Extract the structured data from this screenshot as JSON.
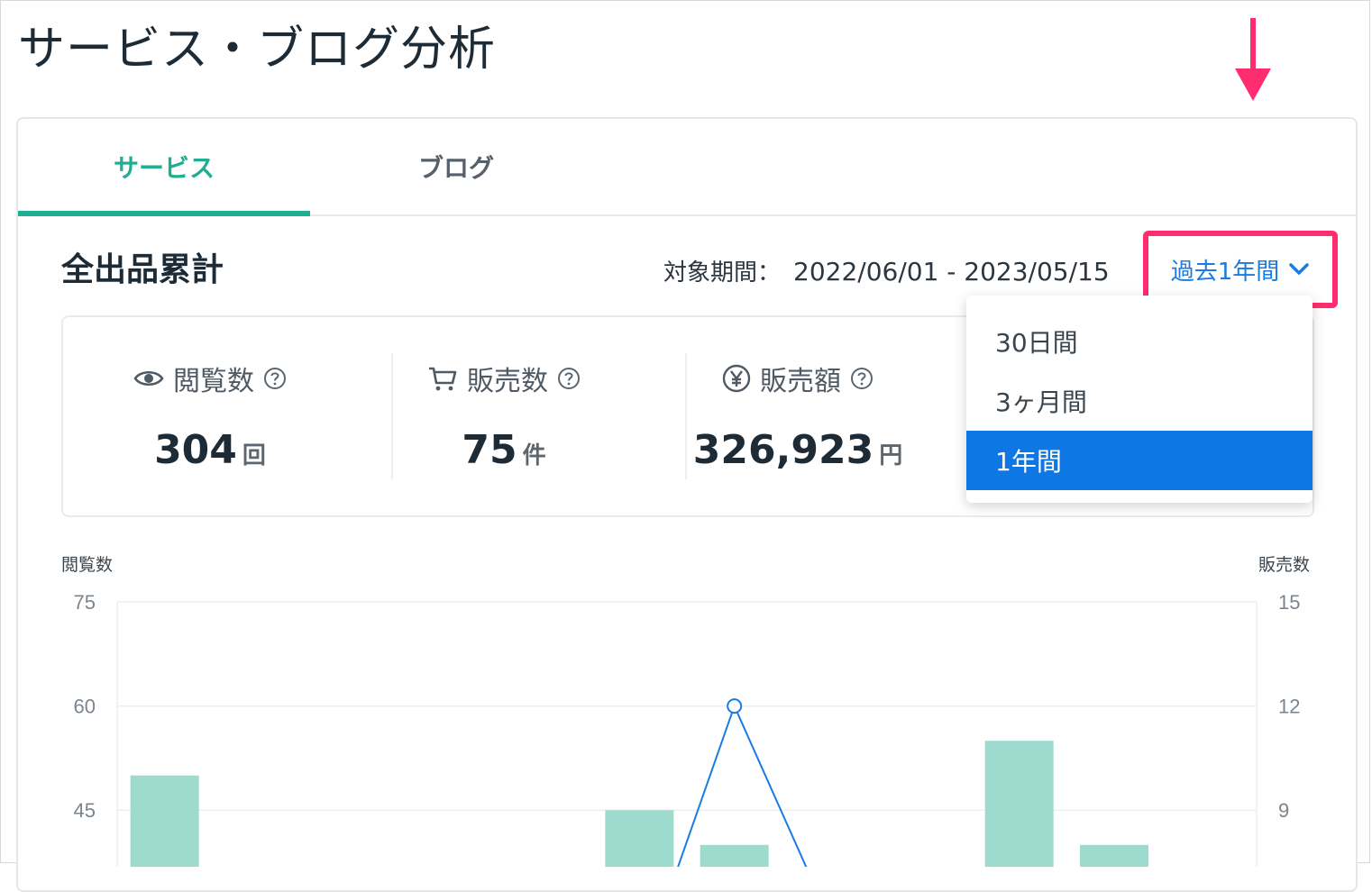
{
  "page": {
    "title": "サービス・ブログ分析"
  },
  "tabs": [
    {
      "label": "サービス",
      "active": true
    },
    {
      "label": "ブログ",
      "active": false
    }
  ],
  "section": {
    "title": "全出品累計",
    "period_label": "対象期間：",
    "period_range": "2022/06/01 - 2023/05/15",
    "period_select": "過去1年間"
  },
  "stats": [
    {
      "label": "閲覧数",
      "value": "304",
      "unit": "回",
      "icon": "eye-icon"
    },
    {
      "label": "販売数",
      "value": "75",
      "unit": "件",
      "icon": "cart-icon"
    },
    {
      "label": "販売額",
      "value": "326,923",
      "unit": "円",
      "icon": "yen-icon"
    }
  ],
  "dropdown": {
    "options": [
      "30日間",
      "3ヶ月間",
      "1年間"
    ],
    "selected_index": 2
  },
  "colors": {
    "accent": "#1fae8f",
    "link": "#1a7be0",
    "highlight": "#ff2d6f",
    "selected": "#0f77e3",
    "bar": "#9edbcf",
    "line": "#1a7be0"
  },
  "chart_data": {
    "type": "bar",
    "y_left_label": "閲覧数",
    "y_right_label": "販売数",
    "y_left_ticks": [
      "75",
      "60",
      "45"
    ],
    "y_right_ticks": [
      "15",
      "12",
      "9"
    ],
    "ylim_left": [
      0,
      75
    ],
    "ylim_right": [
      0,
      15
    ],
    "series": [
      {
        "type": "bar",
        "axis": "left",
        "values": [
          50,
          null,
          null,
          null,
          null,
          45,
          40,
          null,
          null,
          55,
          40,
          null
        ]
      },
      {
        "type": "line",
        "axis": "right",
        "values": [
          null,
          null,
          null,
          null,
          null,
          null,
          12,
          null,
          null,
          null,
          null,
          null
        ]
      }
    ]
  }
}
